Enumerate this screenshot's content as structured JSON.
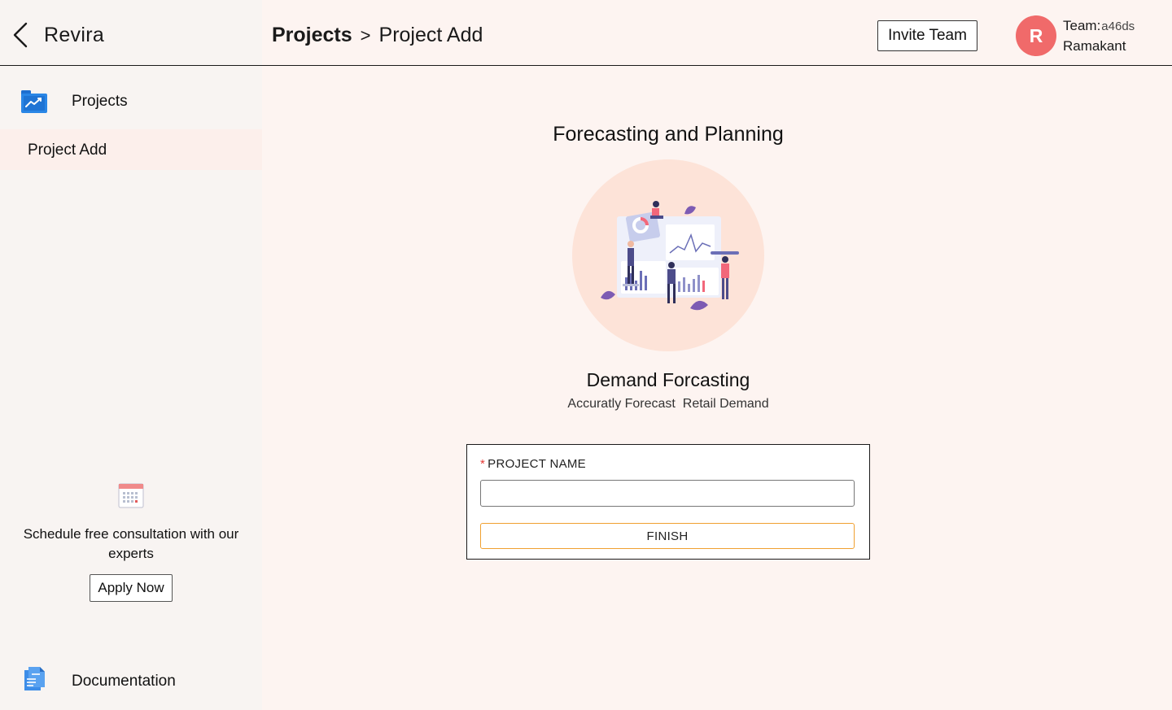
{
  "header": {
    "brand": "Revira",
    "breadcrumb": {
      "root": "Projects",
      "separator": ">",
      "current": "Project Add"
    },
    "invite_label": "Invite Team",
    "avatar_initial": "R",
    "team_label": "Team:",
    "team_value": "a46ds",
    "user_name": "Ramakant"
  },
  "sidebar": {
    "projects_label": "Projects",
    "project_add_label": "Project Add",
    "consultation_text": "Schedule free consultation with our experts",
    "apply_label": "Apply Now",
    "documentation_label": "Documentation"
  },
  "main": {
    "title": "Forecasting and Planning",
    "card_title": "Demand Forcasting",
    "card_subtitle": "Accuratly Forecast  Retail Demand",
    "form": {
      "required_mark": "*",
      "field_label": "PROJECT NAME",
      "field_value": "",
      "finish_label": "FINISH"
    }
  },
  "colors": {
    "background": "#fdf4f1",
    "sidebar_bg": "#f8f4f2",
    "avatar": "#f06a6a",
    "illustration_bg": "#fde3d8",
    "finish_border": "#f0a030",
    "required": "#e53935"
  },
  "icons": {
    "back": "chevron-left-icon",
    "projects": "chart-folder-icon",
    "calendar": "calendar-icon",
    "documentation": "document-icon"
  }
}
